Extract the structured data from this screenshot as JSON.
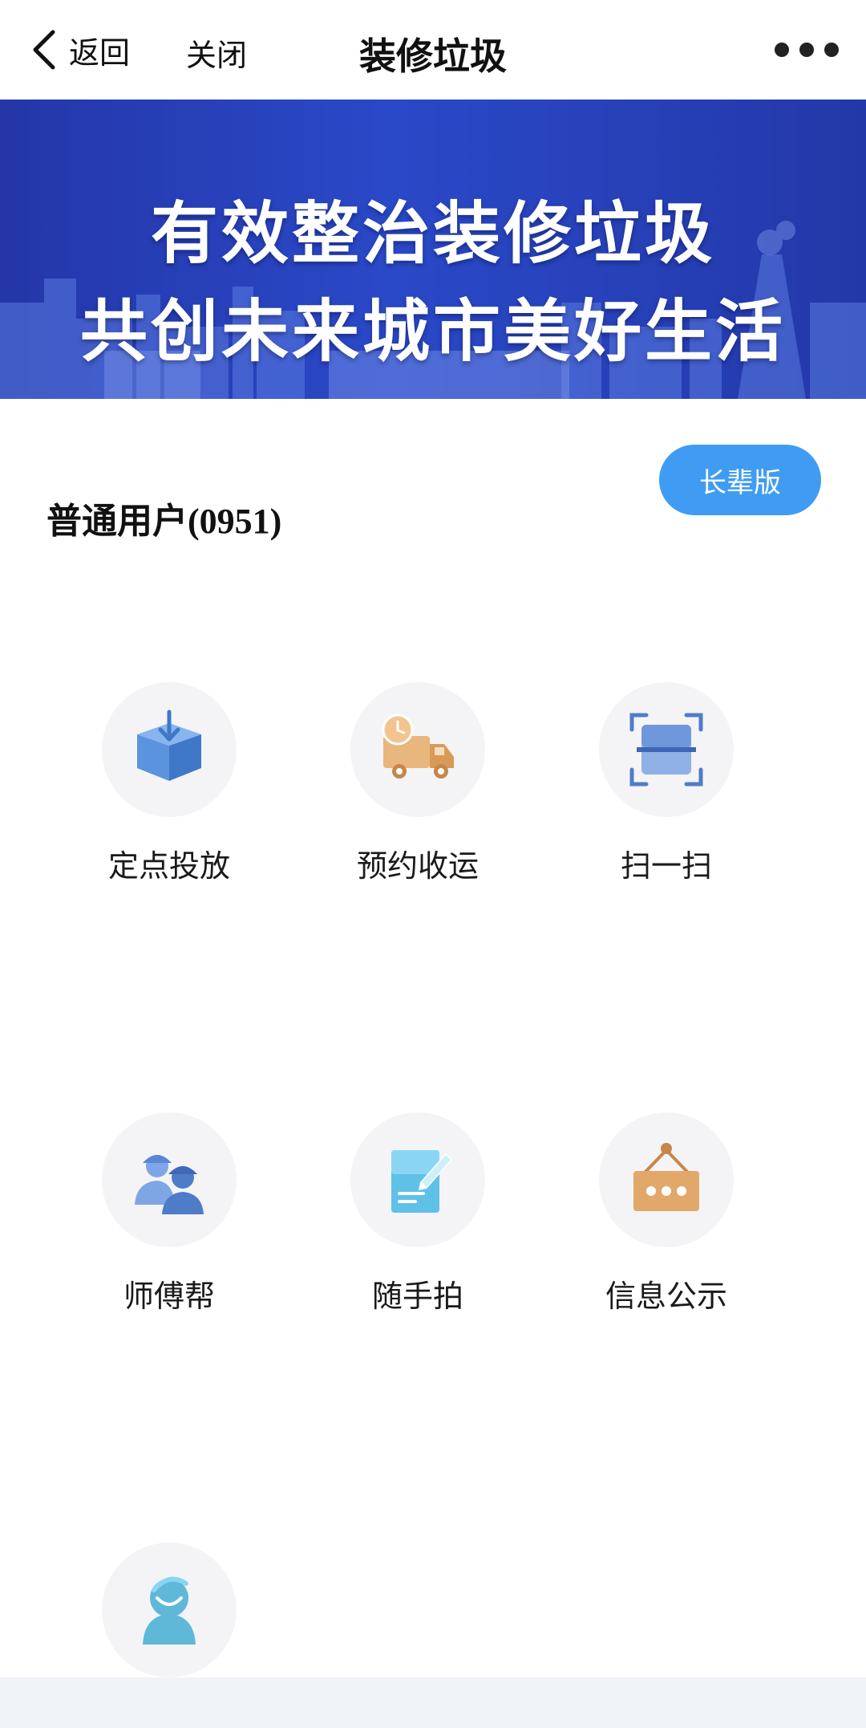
{
  "nav": {
    "back_label": "返回",
    "close_label": "关闭",
    "title": "装修垃圾"
  },
  "banner": {
    "line1": "有效整治装修垃圾",
    "line2": "共创未来城市美好生活"
  },
  "elder_mode_label": "长辈版",
  "user": {
    "role": "普通用户",
    "code": "(0951)"
  },
  "menu": [
    {
      "label": "定点投放",
      "icon": "box-drop-icon"
    },
    {
      "label": "预约收运",
      "icon": "delivery-truck-icon"
    },
    {
      "label": "扫一扫",
      "icon": "scan-icon"
    },
    {
      "label": "师傅帮",
      "icon": "workers-icon"
    },
    {
      "label": "随手拍",
      "icon": "note-pen-icon"
    },
    {
      "label": "信息公示",
      "icon": "notice-board-icon"
    },
    {
      "label": "",
      "icon": "customer-service-icon"
    }
  ],
  "colors": {
    "banner_blue": "#2a49c8",
    "accent_blue": "#3f9cf2",
    "icon_orange": "#e2a86a"
  }
}
